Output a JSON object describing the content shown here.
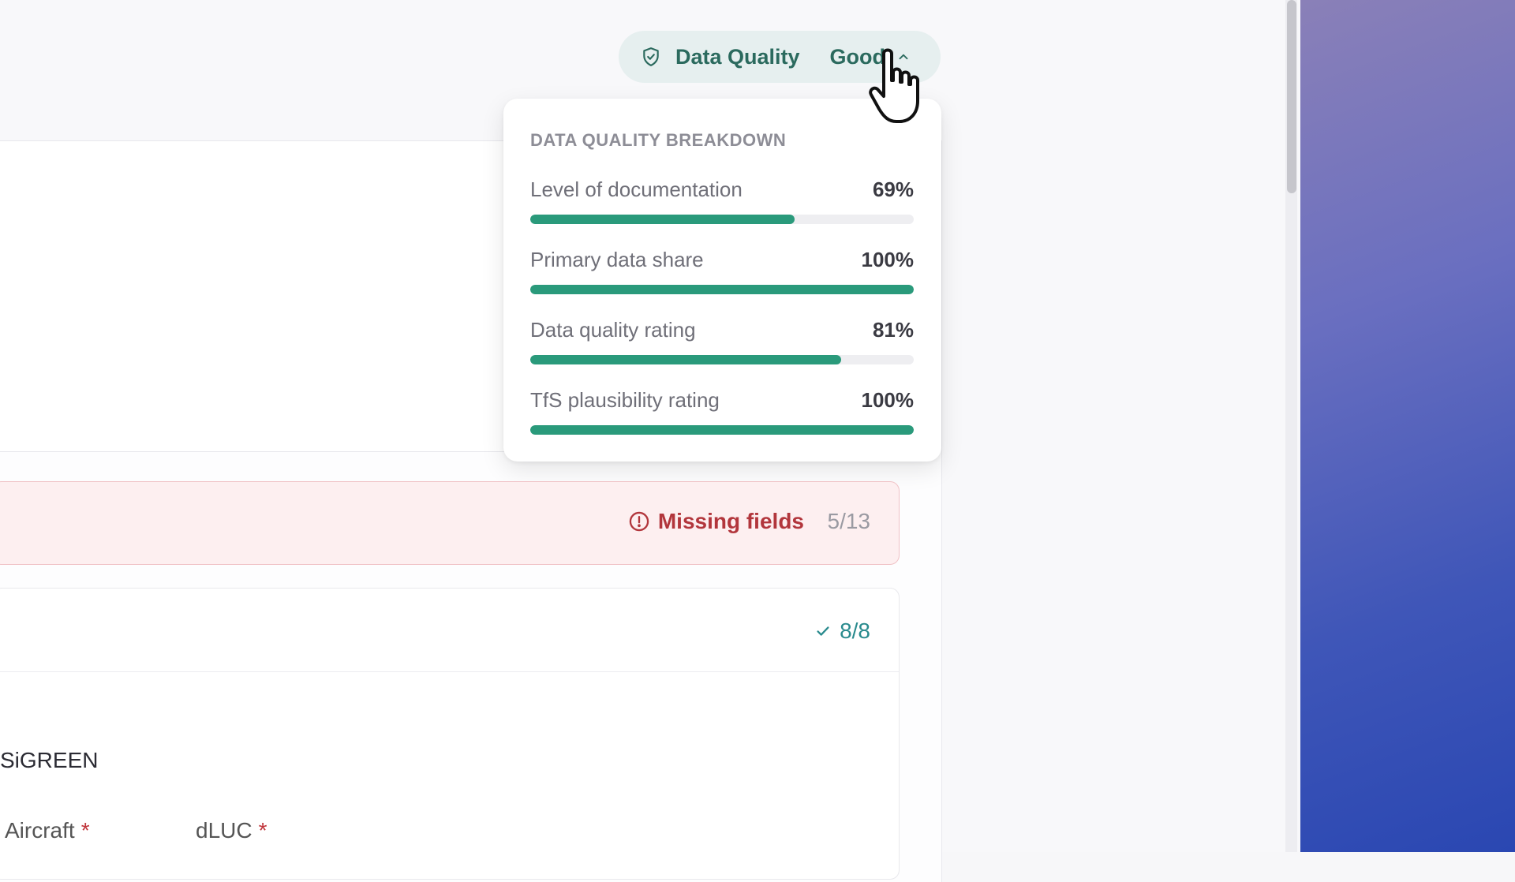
{
  "header": {
    "data_quality_label": "Data Quality",
    "data_quality_value": "Good",
    "shield_icon": "shield-check-icon",
    "chevron_icon": "chevron-up-icon"
  },
  "dropdown": {
    "title": "DATA QUALITY BREAKDOWN",
    "metrics": [
      {
        "label": "Level of documentation",
        "value": "69%",
        "fraction": 0.69
      },
      {
        "label": "Primary data share",
        "value": "100%",
        "fraction": 1.0
      },
      {
        "label": "Data quality rating",
        "value": "81%",
        "fraction": 0.81
      },
      {
        "label": "TfS plausibility rating",
        "value": "100%",
        "fraction": 1.0
      }
    ]
  },
  "missing": {
    "label": "Missing fields",
    "count": "5/13",
    "icon": "alert-circle-icon"
  },
  "complete": {
    "count": "8/8",
    "icon": "check-icon"
  },
  "form": {
    "section_title": "SiGREEN",
    "fields": [
      {
        "label": "Aircraft",
        "required_mark": "*"
      },
      {
        "label": "dLUC",
        "required_mark": "*"
      }
    ]
  },
  "colors": {
    "accent": "#2a9a7b",
    "pill_bg": "#e6efef",
    "missing_text": "#b2363c",
    "missing_bg": "#fdeff0",
    "ok_text": "#2a8b8e"
  }
}
